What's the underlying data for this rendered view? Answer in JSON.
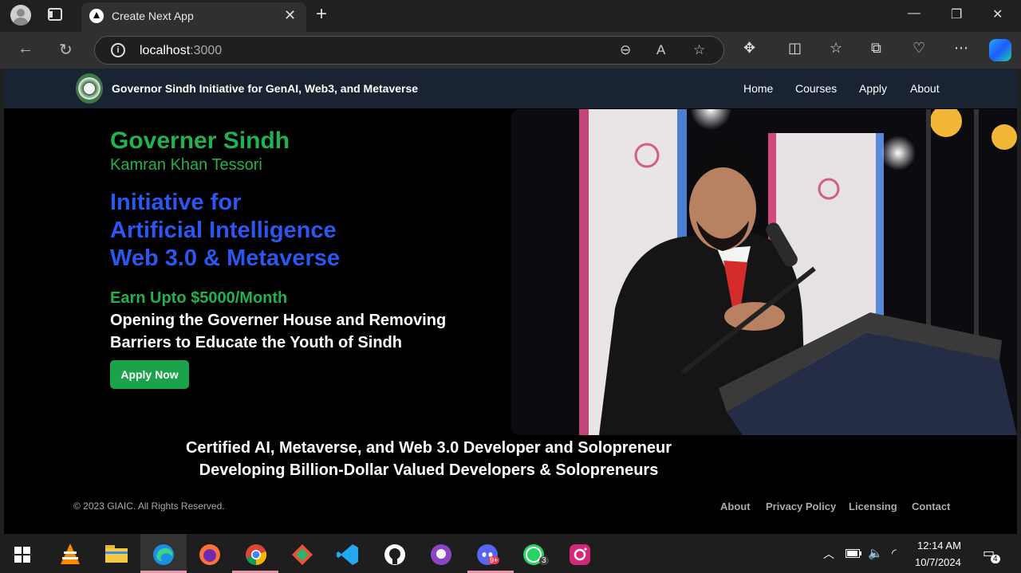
{
  "browser": {
    "tab_title": "Create Next App",
    "url_host": "localhost",
    "url_port": ":3000"
  },
  "site": {
    "title": "Governor Sindh Initiative for GenAI, Web3, and Metaverse",
    "nav": [
      "Home",
      "Courses",
      "Apply",
      "About"
    ]
  },
  "hero": {
    "heading": "Governer Sindh",
    "name": "Kamran Khan Tessori",
    "initiative": [
      "Initiative for",
      "Artificial Intelligence",
      "Web 3.0 & Metaverse"
    ],
    "earn": "Earn Upto $5000/Month",
    "mission": [
      "Opening the Governer House and Removing",
      "Barriers to Educate the Youth of Sindh"
    ],
    "apply_label": "Apply Now"
  },
  "certification": [
    "Certified AI, Metaverse, and Web 3.0 Developer and Solopreneur",
    "Developing Billion-Dollar Valued Developers & Solopreneurs"
  ],
  "footer": {
    "copyright": "© 2023 GIAIC. All Rights Reserved.",
    "links": [
      "About",
      "Privacy Policy",
      "Licensing",
      "Contact"
    ]
  },
  "taskbar": {
    "time": "12:14 AM",
    "date": "10/7/2024",
    "whatsapp_badge": "3",
    "notifications_badge": "4",
    "discord_badge": "9+"
  },
  "colors": {
    "nav_bg": "#1a2332",
    "green": "#22b14c",
    "blue": "#2b57f0",
    "button": "#1aa34a"
  }
}
